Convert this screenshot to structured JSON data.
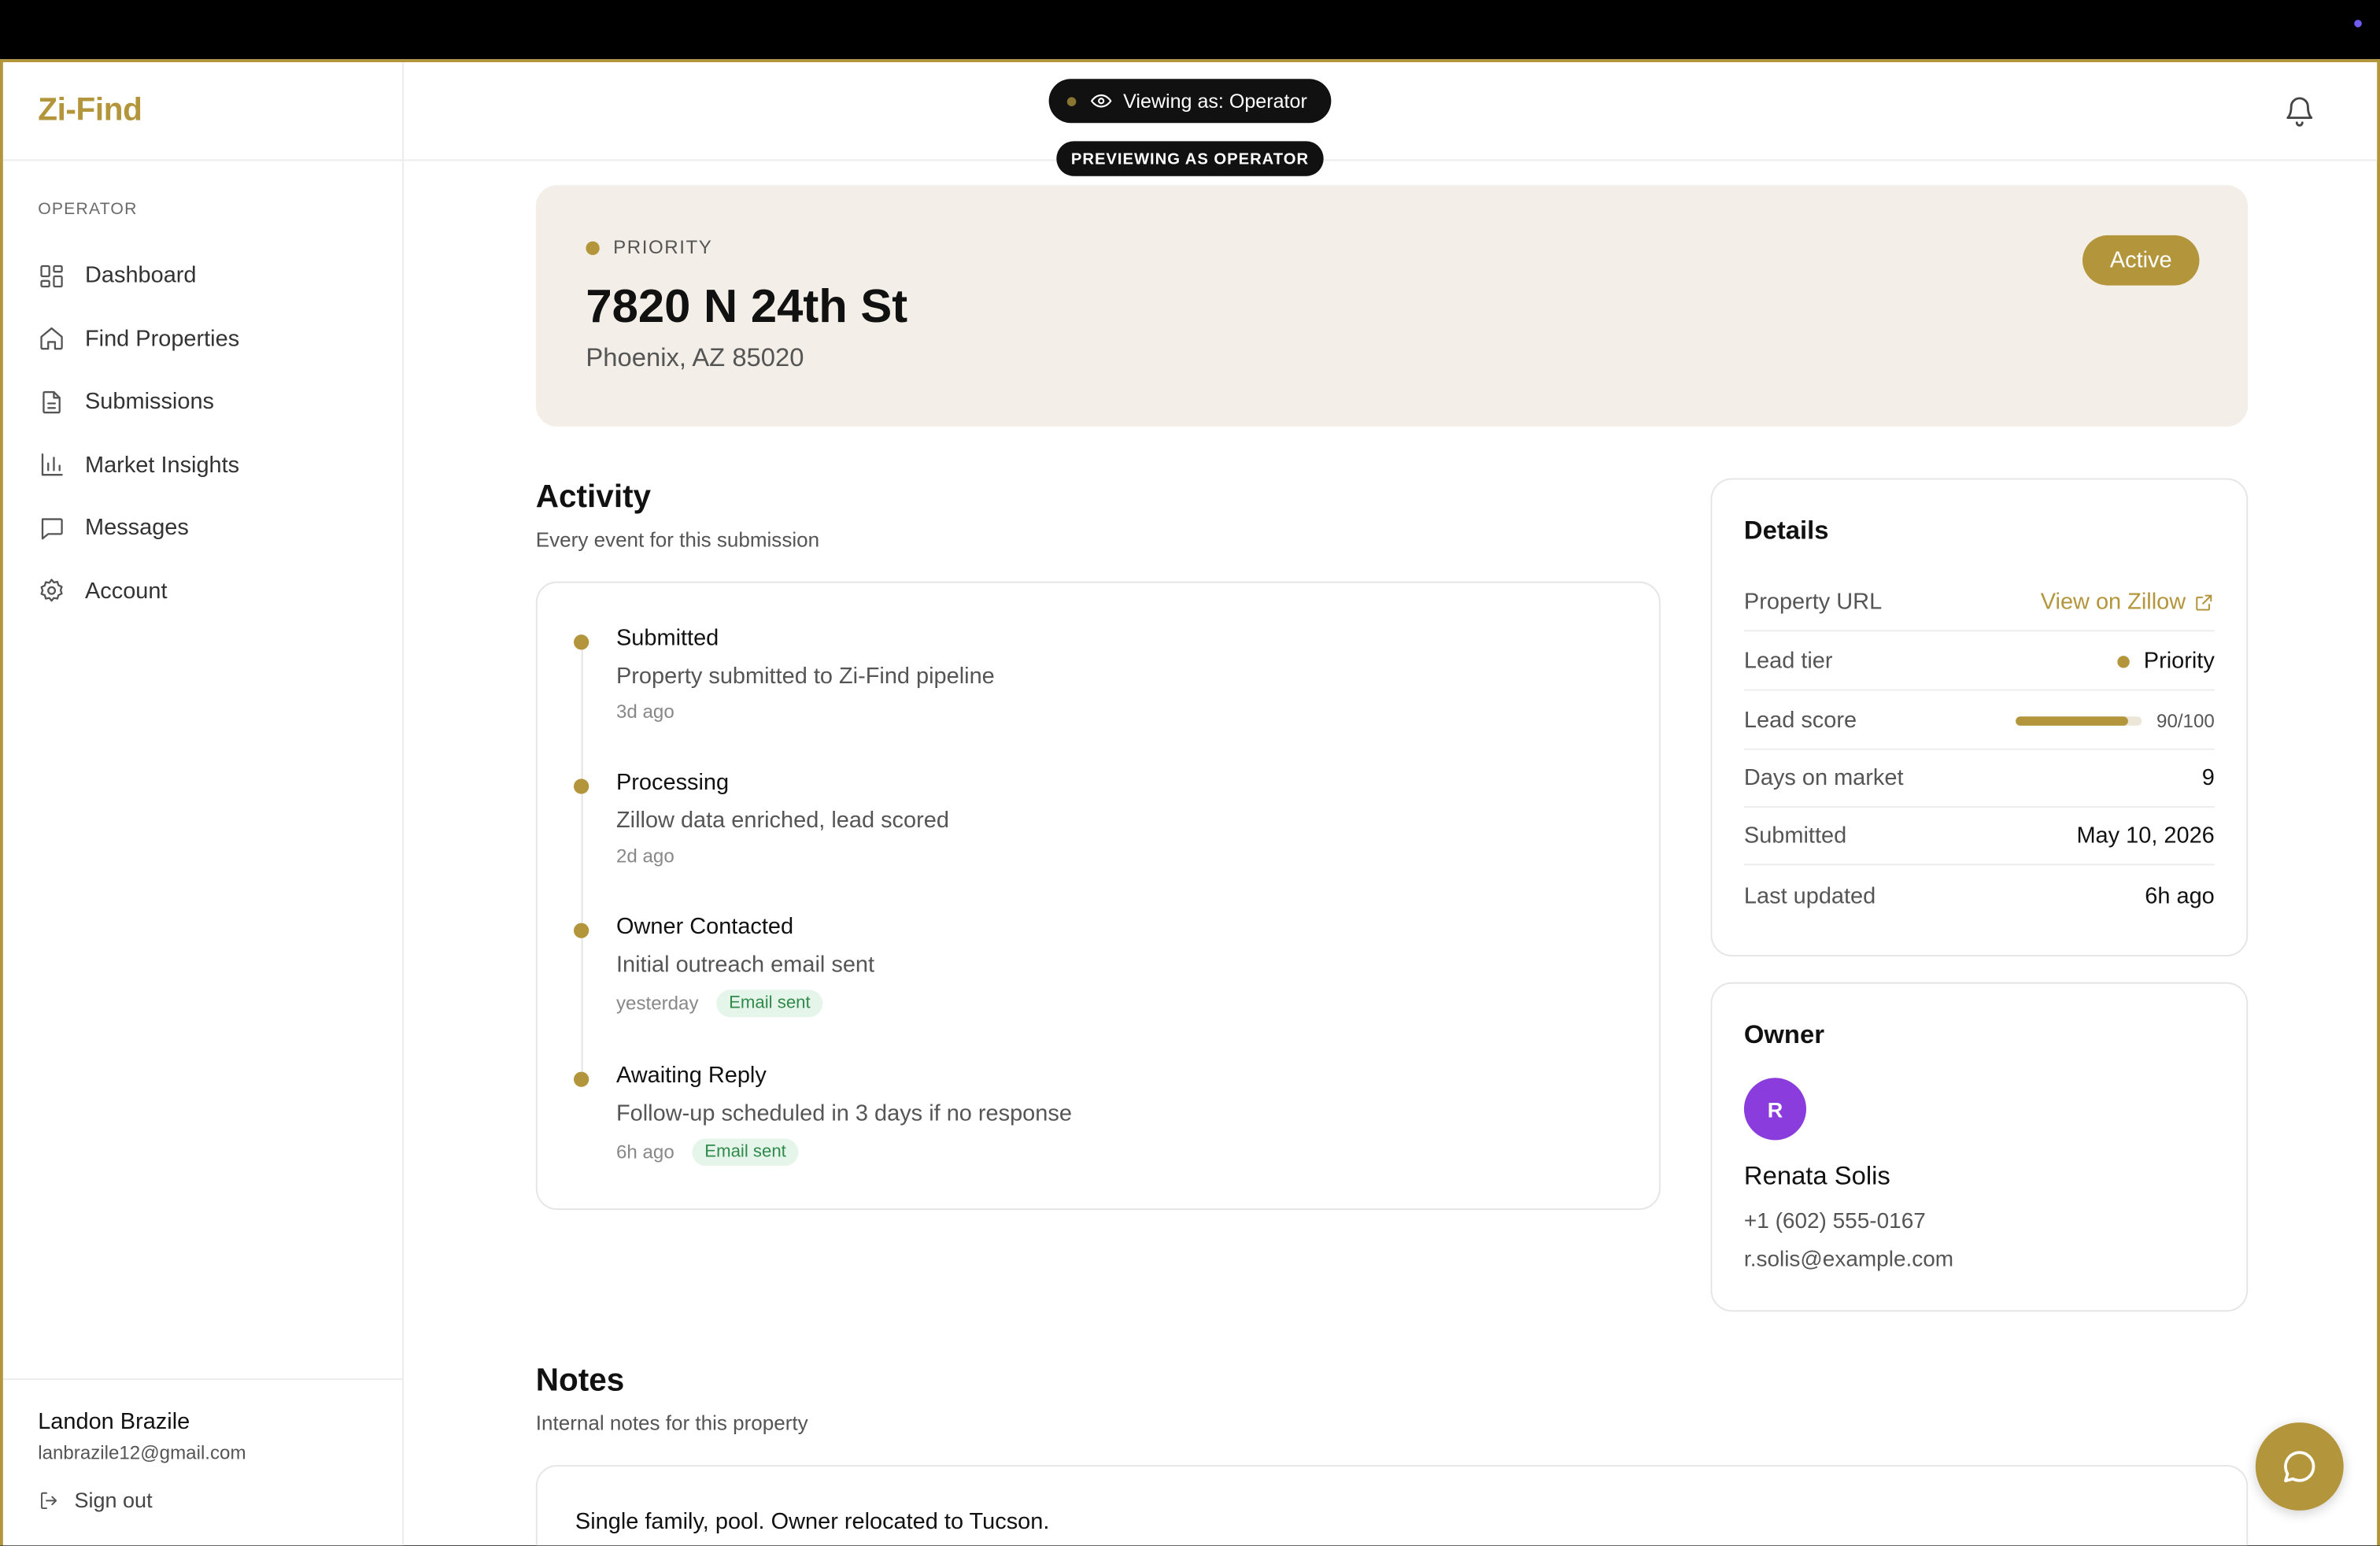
{
  "app": {
    "logo": "Zi-Find",
    "accent_color": "#b3953c"
  },
  "viewing": {
    "pill_label": "Viewing as: Operator",
    "preview_badge": "PREVIEWING AS OPERATOR"
  },
  "sidebar": {
    "section_label": "OPERATOR",
    "items": [
      {
        "label": "Dashboard",
        "icon": "grid-icon"
      },
      {
        "label": "Find Properties",
        "icon": "home-icon"
      },
      {
        "label": "Submissions",
        "icon": "document-icon"
      },
      {
        "label": "Market Insights",
        "icon": "bar-chart-icon"
      },
      {
        "label": "Messages",
        "icon": "message-icon"
      },
      {
        "label": "Account",
        "icon": "gear-icon"
      }
    ],
    "user": {
      "name": "Landon Brazile",
      "email": "lanbrazile12@gmail.com"
    },
    "sign_out": "Sign out"
  },
  "header": {
    "bell_icon": "bell-icon"
  },
  "property": {
    "tier_label": "PRIORITY",
    "address": "7820 N 24th St",
    "city_line": "Phoenix, AZ 85020",
    "status": "Active"
  },
  "activity": {
    "title": "Activity",
    "subtitle": "Every event for this submission",
    "events": [
      {
        "title": "Submitted",
        "description": "Property submitted to Zi-Find pipeline",
        "time": "3d ago",
        "tag": ""
      },
      {
        "title": "Processing",
        "description": "Zillow data enriched, lead scored",
        "time": "2d ago",
        "tag": ""
      },
      {
        "title": "Owner Contacted",
        "description": "Initial outreach email sent",
        "time": "yesterday",
        "tag": "Email sent"
      },
      {
        "title": "Awaiting Reply",
        "description": "Follow-up scheduled in 3 days if no response",
        "time": "6h ago",
        "tag": "Email sent"
      }
    ]
  },
  "details": {
    "title": "Details",
    "property_url": {
      "label": "Property URL",
      "value": "View on Zillow"
    },
    "lead_tier": {
      "label": "Lead tier",
      "value": "Priority"
    },
    "lead_score": {
      "label": "Lead score",
      "value": "90/100",
      "score": 90,
      "max": 100
    },
    "days_on_market": {
      "label": "Days on market",
      "value": "9"
    },
    "submitted": {
      "label": "Submitted",
      "value": "May 10, 2026"
    },
    "last_updated": {
      "label": "Last updated",
      "value": "6h ago"
    }
  },
  "owner": {
    "title": "Owner",
    "initial": "R",
    "avatar_color": "#8a3cdc",
    "name": "Renata Solis",
    "phone": "+1 (602) 555-0167",
    "email": "r.solis@example.com"
  },
  "notes": {
    "title": "Notes",
    "subtitle": "Internal notes for this property",
    "text": "Single family, pool. Owner relocated to Tucson."
  }
}
